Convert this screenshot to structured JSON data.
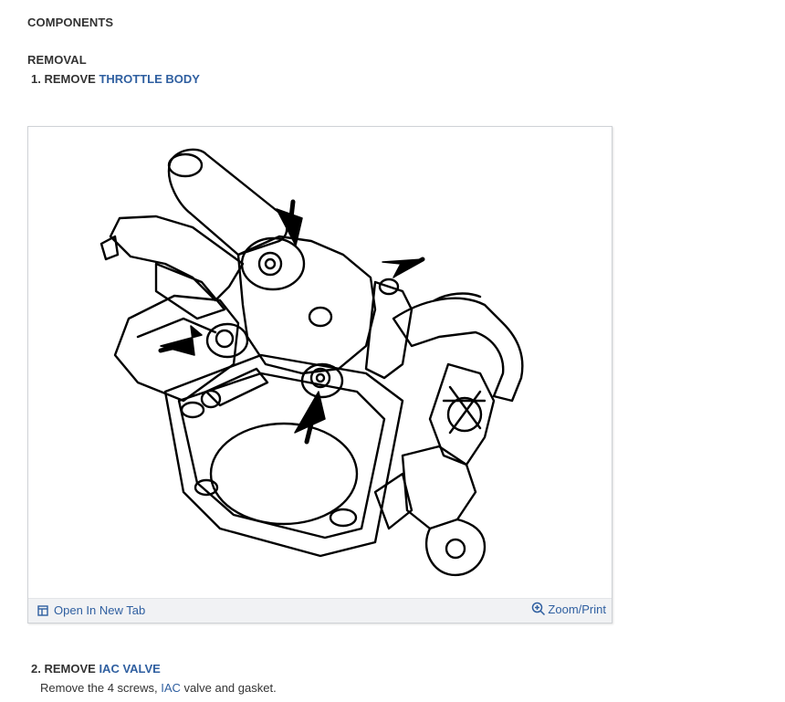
{
  "section_title": "COMPONENTS",
  "subsection_title": "REMOVAL",
  "steps": [
    {
      "number": "1.",
      "prefix": "REMOVE",
      "link": "THROTTLE BODY"
    },
    {
      "number": "2.",
      "prefix": "REMOVE",
      "link": "IAC VALVE",
      "description_before": "Remove the 4 screws, ",
      "description_link": "IAC",
      "description_after": " valve and gasket."
    }
  ],
  "figure": {
    "open_label": "Open In New Tab",
    "zoom_label": "Zoom/Print",
    "open_icon": "open-in-new-tab-icon",
    "zoom_icon": "zoom-in-icon"
  },
  "colors": {
    "text": "#333333",
    "link": "#2f5fa0",
    "toolbar": "#f1f2f4"
  }
}
